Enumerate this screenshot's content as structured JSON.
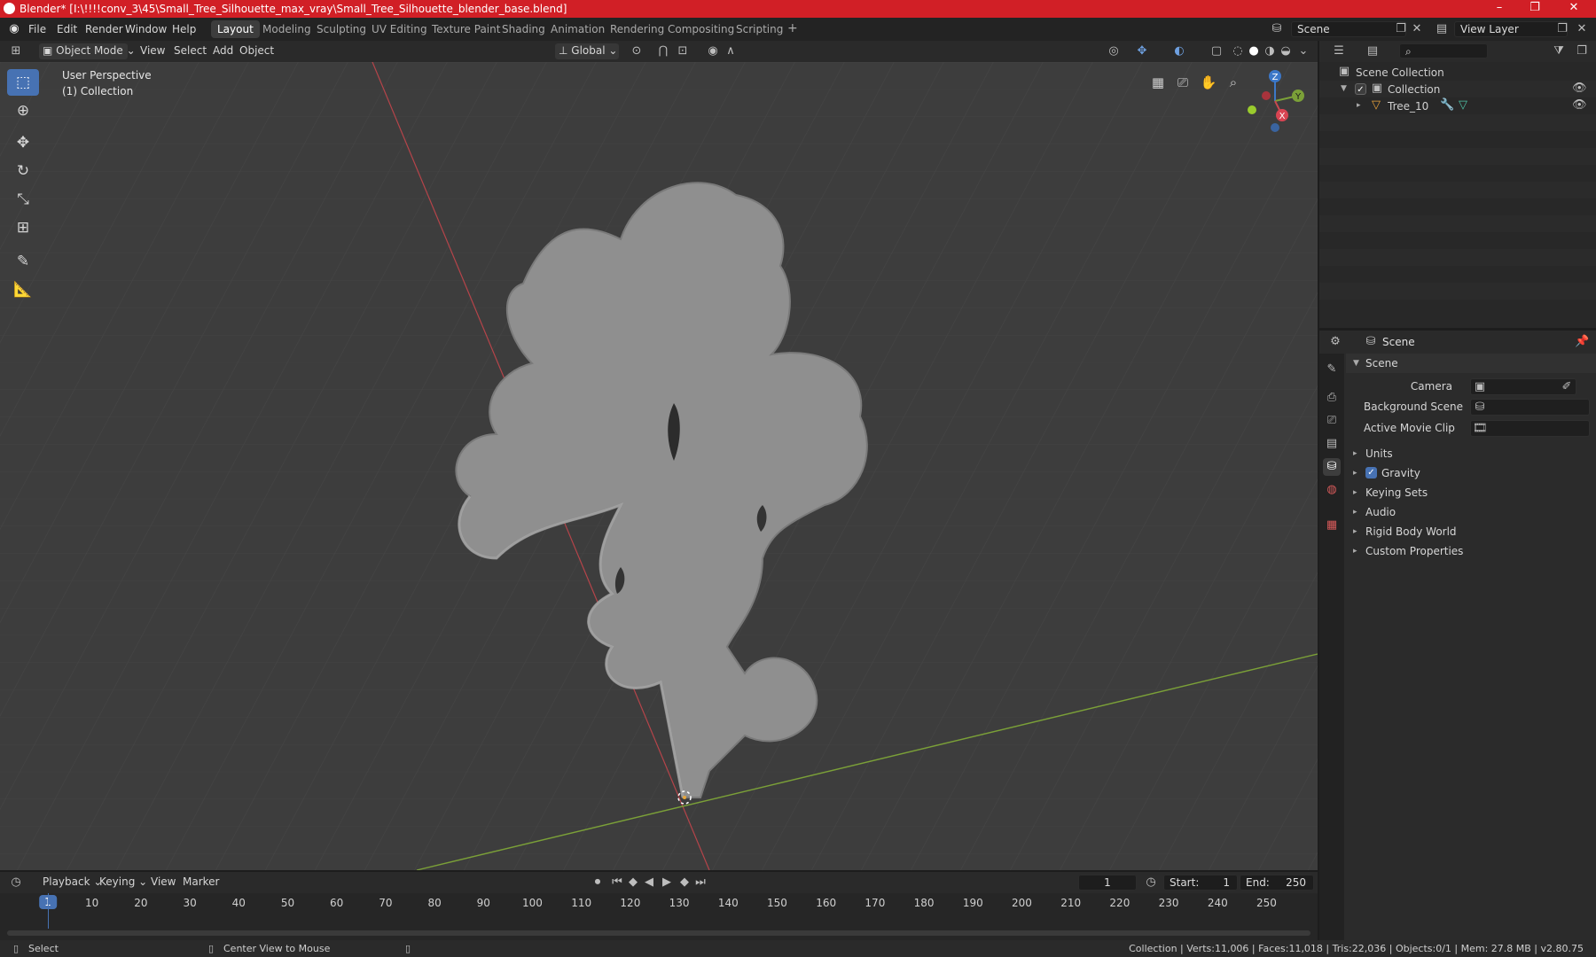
{
  "window": {
    "title": "Blender* [I:\\!!!!conv_3\\45\\Small_Tree_Silhouette_max_vray\\Small_Tree_Silhouette_blender_base.blend]",
    "controls": [
      "–",
      "❐",
      "✕"
    ]
  },
  "menu": {
    "items": [
      "File",
      "Edit",
      "Render",
      "Window",
      "Help"
    ],
    "workspaces": [
      "Layout",
      "Modeling",
      "Sculpting",
      "UV Editing",
      "Texture Paint",
      "Shading",
      "Animation",
      "Rendering",
      "Compositing",
      "Scripting"
    ],
    "active_workspace": "Layout",
    "add_workspace": "+",
    "scene_field": "Scene",
    "view_layer_field": "View Layer"
  },
  "viewport_header": {
    "mode": "Object Mode",
    "menus": [
      "View",
      "Select",
      "Add",
      "Object"
    ],
    "orientation": "Global"
  },
  "viewport": {
    "perspective_label": "User Perspective",
    "collection_label": "(1) Collection",
    "tools": [
      "select-box-icon",
      "cursor-icon",
      "move-icon",
      "rotate-icon",
      "scale-icon",
      "transform-icon",
      "annotate-icon",
      "measure-icon"
    ],
    "nav_gizmo": {
      "z": "Z",
      "y": "Y",
      "x": "X"
    }
  },
  "outliner": {
    "search_placeholder": "",
    "rows": [
      {
        "label": "Scene Collection",
        "indent": 0
      },
      {
        "label": "Collection",
        "indent": 1
      },
      {
        "label": "Tree_10",
        "indent": 2
      }
    ]
  },
  "properties": {
    "header_title": "Scene",
    "section": "Scene",
    "fields": [
      {
        "label": "Camera"
      },
      {
        "label": "Background Scene"
      },
      {
        "label": "Active Movie Clip"
      }
    ],
    "panels": [
      "Units",
      "Gravity",
      "Keying Sets",
      "Audio",
      "Rigid Body World",
      "Custom Properties"
    ],
    "gravity_checked": true
  },
  "timeline": {
    "menus": [
      "Playback",
      "Keying",
      "View",
      "Marker"
    ],
    "current_frame": "1",
    "start_label": "Start:",
    "start_value": "1",
    "end_label": "End:",
    "end_value": "250",
    "ticks": [
      "1",
      "10",
      "20",
      "30",
      "40",
      "50",
      "60",
      "70",
      "80",
      "90",
      "100",
      "110",
      "120",
      "130",
      "140",
      "150",
      "160",
      "170",
      "180",
      "190",
      "200",
      "210",
      "220",
      "230",
      "240",
      "250"
    ]
  },
  "statusbar": {
    "left_action": "Select",
    "middle_action": "Center View to Mouse",
    "stats": "Collection | Verts:11,006 | Faces:11,018 | Tris:22,036 | Objects:0/1 | Mem: 27.8 MB | v2.80.75"
  },
  "colors": {
    "title_bar": "#d11f26",
    "accent": "#4772b3",
    "x_axis": "#c9484f",
    "y_axis": "#7ea33a",
    "model": "#8d8d8d"
  }
}
